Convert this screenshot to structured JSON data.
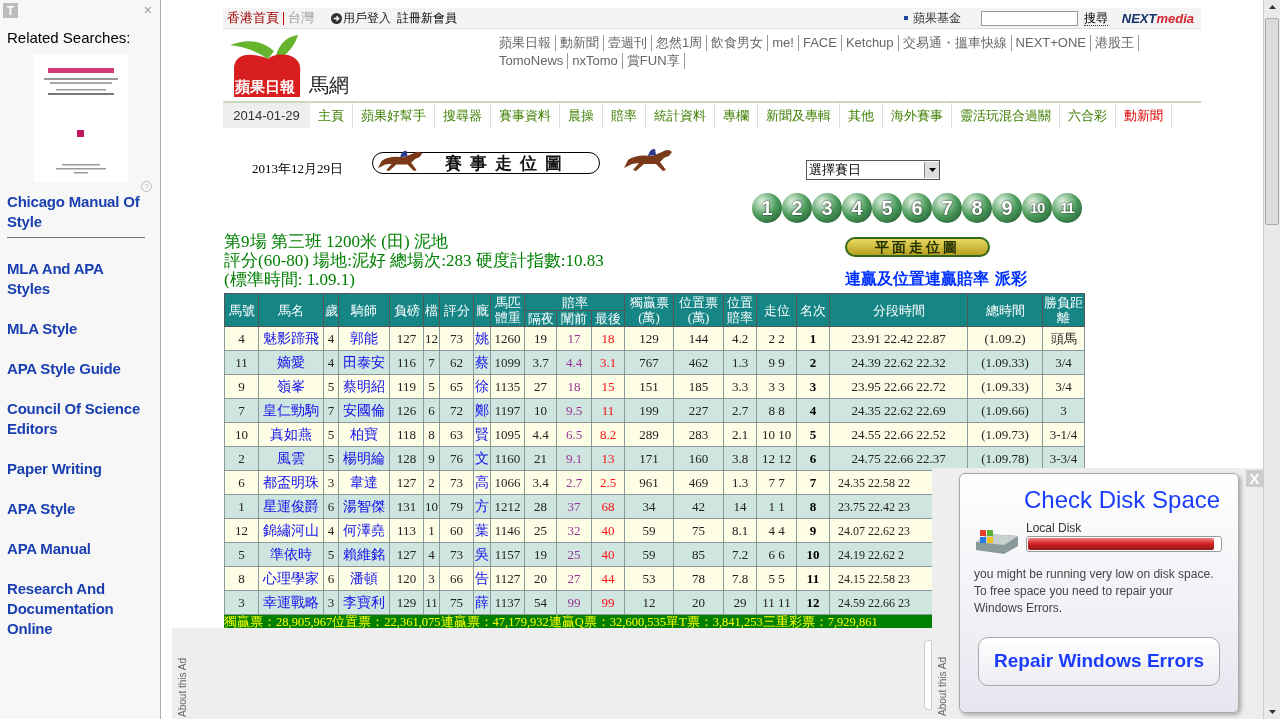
{
  "sidebar": {
    "badge": "T",
    "close": "×",
    "title": "Related Searches:",
    "help": "?",
    "items": [
      {
        "label": "Chicago Manual Of Style"
      },
      {
        "label": "MLA And APA Styles"
      },
      {
        "label": "MLA Style"
      },
      {
        "label": "APA Style Guide"
      },
      {
        "label": "Council Of Science Editors"
      },
      {
        "label": "Paper Writing"
      },
      {
        "label": "APA Style"
      },
      {
        "label": "APA Manual"
      },
      {
        "label": "Research And Documentation Online"
      }
    ]
  },
  "top_bar": {
    "home": "香港首頁",
    "region": "台灣",
    "login": "用戶登入",
    "register": "註冊新會員",
    "foundation": "蘋果基金",
    "search_button": "搜尋",
    "brand": [
      "NEXT",
      "media"
    ]
  },
  "header": {
    "logo": "蘋果日報",
    "section": "馬網",
    "links": [
      "蘋果日報",
      "動新聞",
      "壹週刊",
      "忽然1周",
      "飲食男女",
      "me!",
      "FACE",
      "Ketchup",
      "交易通・搵車快線",
      "NEXT+ONE",
      "港股王",
      "TomoNews",
      "nxTomo",
      "賞FUN享"
    ]
  },
  "nav": {
    "date": "2014-01-29",
    "items": [
      {
        "label": "主頁",
        "kind": "link"
      },
      {
        "label": "蘋果好幫手",
        "kind": "link"
      },
      {
        "label": "搜尋器",
        "kind": "link"
      },
      {
        "label": "賽事資料",
        "kind": "link"
      },
      {
        "label": "晨操",
        "kind": "link"
      },
      {
        "label": "賠率",
        "kind": "link"
      },
      {
        "label": "統計資料",
        "kind": "link"
      },
      {
        "label": "專欄",
        "kind": "link"
      },
      {
        "label": "新聞及專輯",
        "kind": "link"
      },
      {
        "label": "其他",
        "kind": "link"
      },
      {
        "label": "海外賽事",
        "kind": "link"
      },
      {
        "label": "靈活玩混合過關",
        "kind": "link"
      },
      {
        "label": "六合彩",
        "kind": "link"
      },
      {
        "label": "動新聞",
        "kind": "highlight"
      }
    ]
  },
  "race": {
    "date": "2013年12月29日",
    "banner": "賽事走位圖",
    "select": "選擇賽日",
    "races": [
      "1",
      "2",
      "3",
      "4",
      "5",
      "6",
      "7",
      "8",
      "9",
      "10",
      "11"
    ],
    "title_lines": [
      "第9場 第三班 1200米 (田) 泥地",
      "評分(60-80) 場地:泥好 總場次:283 硬度計指數:10.83",
      "(標準時間: 1.09.1)"
    ],
    "map_button": "平面走位圖",
    "links": [
      "連贏及位置連贏賠率",
      "派彩"
    ]
  },
  "table": {
    "header_rows": [
      [
        {
          "label": "馬號",
          "rowspan": 2
        },
        {
          "label": "馬名",
          "rowspan": 2
        },
        {
          "label": "歲",
          "rowspan": 2
        },
        {
          "label": "騎師",
          "rowspan": 2
        },
        {
          "label": "負磅",
          "rowspan": 2
        },
        {
          "label": "檔",
          "rowspan": 2
        },
        {
          "label": "評分",
          "rowspan": 2
        },
        {
          "label": "廐",
          "rowspan": 2
        },
        {
          "label": "馬匹體重",
          "rowspan": 2
        },
        {
          "label": "賠率",
          "colspan": 3
        },
        {
          "label": "獨贏票(萬)",
          "rowspan": 2
        },
        {
          "label": "位置票(萬)",
          "rowspan": 2
        },
        {
          "label": "位置賠率",
          "rowspan": 2
        },
        {
          "label": "走位",
          "rowspan": 2
        },
        {
          "label": "名次",
          "rowspan": 2
        },
        {
          "label": "分段時間",
          "rowspan": 2
        },
        {
          "label": "總時間",
          "rowspan": 2
        },
        {
          "label": "勝負距離",
          "rowspan": 2
        }
      ],
      [
        {
          "label": "隔夜"
        },
        {
          "label": "闡前"
        },
        {
          "label": "最後"
        }
      ]
    ],
    "rows": [
      {
        "cells": [
          "4",
          "魅影蹄飛",
          "4",
          "郭能",
          "127",
          "12",
          "73",
          "姚",
          "1260",
          "19",
          "17",
          "18",
          "129",
          "144",
          "4.2",
          "2 2",
          "1",
          "23.91 22.42 22.87",
          "(1.09.2)",
          "頭馬"
        ]
      },
      {
        "cells": [
          "11",
          "嫡愛",
          "4",
          "田泰安",
          "116",
          "7",
          "62",
          "蔡",
          "1099",
          "3.7",
          "4.4",
          "3.1",
          "767",
          "462",
          "1.3",
          "9 9",
          "2",
          "24.39 22.62 22.32",
          "(1.09.33)",
          "3/4"
        ]
      },
      {
        "cells": [
          "9",
          "嶺峯",
          "5",
          "蔡明紹",
          "119",
          "5",
          "65",
          "徐",
          "1135",
          "27",
          "18",
          "15",
          "151",
          "185",
          "3.3",
          "3 3",
          "3",
          "23.95 22.66 22.72",
          "(1.09.33)",
          "3/4"
        ]
      },
      {
        "cells": [
          "7",
          "皇仁勁駒",
          "7",
          "安國倫",
          "126",
          "6",
          "72",
          "鄭",
          "1197",
          "10",
          "9.5",
          "11",
          "199",
          "227",
          "2.7",
          "8 8",
          "4",
          "24.35 22.62 22.69",
          "(1.09.66)",
          "3"
        ]
      },
      {
        "cells": [
          "10",
          "真如燕",
          "5",
          "柏寶",
          "118",
          "8",
          "63",
          "賢",
          "1095",
          "4.4",
          "6.5",
          "8.2",
          "289",
          "283",
          "2.1",
          "10 10",
          "5",
          "24.55 22.66 22.52",
          "(1.09.73)",
          "3-1/4"
        ]
      },
      {
        "cells": [
          "2",
          "風雲",
          "5",
          "楊明綸",
          "128",
          "9",
          "76",
          "文",
          "1160",
          "21",
          "9.1",
          "13",
          "171",
          "160",
          "3.8",
          "12 12",
          "6",
          "24.75 22.66 22.37",
          "(1.09.78)",
          "3-3/4"
        ]
      },
      {
        "cells": [
          "6",
          "都盃明珠",
          "3",
          "韋達",
          "127",
          "2",
          "73",
          "高",
          "1066",
          "3.4",
          "2.7",
          "2.5",
          "961",
          "469",
          "1.3",
          "7 7",
          "7",
          "24.35 22.58 22"
        ]
      },
      {
        "cells": [
          "1",
          "星運俊爵",
          "6",
          "湯智傑",
          "131",
          "10",
          "79",
          "方",
          "1212",
          "28",
          "37",
          "68",
          "34",
          "42",
          "14",
          "1 1",
          "8",
          "23.75 22.42 23"
        ]
      },
      {
        "cells": [
          "12",
          "錦繡河山",
          "4",
          "何澤堯",
          "113",
          "1",
          "60",
          "葉",
          "1146",
          "25",
          "32",
          "40",
          "59",
          "75",
          "8.1",
          "4 4",
          "9",
          "24.07 22.62 23"
        ]
      },
      {
        "cells": [
          "5",
          "準依時",
          "5",
          "賴維銘",
          "127",
          "4",
          "73",
          "吳",
          "1157",
          "19",
          "25",
          "40",
          "59",
          "85",
          "7.2",
          "6 6",
          "10",
          "24.19 22.62 2"
        ]
      },
      {
        "cells": [
          "8",
          "心理學家",
          "6",
          "潘頓",
          "120",
          "3",
          "66",
          "告",
          "1127",
          "20",
          "27",
          "44",
          "53",
          "78",
          "7.8",
          "5 5",
          "11",
          "24.15 22.58 23"
        ]
      },
      {
        "cells": [
          "3",
          "幸運戰略",
          "3",
          "李寶利",
          "129",
          "11",
          "75",
          "薛",
          "1137",
          "54",
          "99",
          "99",
          "12",
          "20",
          "29",
          "11 11",
          "12",
          "24.59 22.66 23"
        ]
      }
    ],
    "footer": "獨贏票：28,905,967位置票：22,361,075連贏票：47,179,932連贏Q票：32,600,535單T票：3,841,253三重彩票：7,929,861"
  },
  "ads": {
    "about": [
      "About this Ad",
      "About this Ad"
    ],
    "close": "X",
    "popup": {
      "title": "Check Disk Space",
      "disk_label": "Local Disk",
      "level": 0.97,
      "message": "you might be running very low on disk space. To free space you need to repair your Windows Errors.",
      "button": "Repair Windows Errors"
    }
  }
}
